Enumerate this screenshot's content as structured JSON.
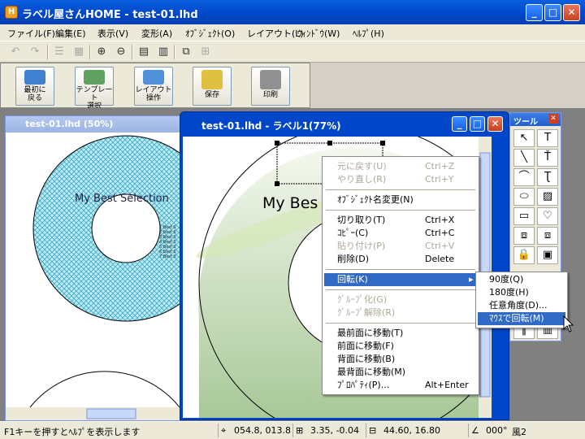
{
  "window": {
    "title": "ラベル屋さんHOME - test-01.lhd",
    "icon_label": "H"
  },
  "menu": [
    "ファイル(F)",
    "編集(E)",
    "表示(V)",
    "変形(A)",
    "ｵﾌﾞｼﾞｪｸﾄ(O)",
    "レイアウト(L)",
    "ｳｨﾝﾄﾞｳ(W)",
    "ﾍﾙﾌﾟ(H)"
  ],
  "big_buttons": [
    {
      "label1": "最初に",
      "label2": "戻る",
      "color": "#4080d0"
    },
    {
      "label1": "テンプレート",
      "label2": "選択",
      "color": "#60a060"
    },
    {
      "label1": "レイアウト",
      "label2": "操作",
      "color": "#5090d8"
    },
    {
      "label1": "保存",
      "label2": "",
      "color": "#e0c040"
    },
    {
      "label1": "印刷",
      "label2": "",
      "color": "#909090"
    }
  ],
  "doc1": {
    "title": "test-01.lhd (50%)",
    "cd_text": "My Best Selection",
    "track_lines": [
      "1.Best S",
      "2.Best S",
      "3.Best S",
      "4.Best S",
      "5.Best S",
      "6.Best S",
      "7.Best S"
    ]
  },
  "doc2": {
    "title": "test-01.lhd - ラベル1(77%)",
    "cd_text": "My Bes"
  },
  "tool": {
    "title": "ツール"
  },
  "context_menu": [
    {
      "label": "元に戻す(U)",
      "shortcut": "Ctrl+Z",
      "state": "disabled"
    },
    {
      "label": "やり直し(R)",
      "shortcut": "Ctrl+Y",
      "state": "disabled"
    },
    {
      "label": "ｵﾌﾞｼﾞｪｸﾄ名変更(N)",
      "shortcut": "",
      "state": "enabled"
    },
    {
      "label": "切り取り(T)",
      "shortcut": "Ctrl+X",
      "state": "enabled"
    },
    {
      "label": "ｺﾋﾟｰ(C)",
      "shortcut": "Ctrl+C",
      "state": "enabled"
    },
    {
      "label": "貼り付け(P)",
      "shortcut": "Ctrl+V",
      "state": "disabled"
    },
    {
      "label": "削除(D)",
      "shortcut": "Delete",
      "state": "enabled"
    },
    {
      "label": "回転(K)",
      "shortcut": "",
      "state": "selected"
    },
    {
      "label": "ｸﾞﾙｰﾌﾟ化(G)",
      "shortcut": "",
      "state": "disabled"
    },
    {
      "label": "ｸﾞﾙｰﾌﾟ解除(R)",
      "shortcut": "",
      "state": "disabled"
    },
    {
      "label": "最前面に移動(T)",
      "shortcut": "",
      "state": "enabled"
    },
    {
      "label": "前面に移動(F)",
      "shortcut": "",
      "state": "enabled"
    },
    {
      "label": "背面に移動(B)",
      "shortcut": "",
      "state": "enabled"
    },
    {
      "label": "最背面に移動(M)",
      "shortcut": "",
      "state": "enabled"
    },
    {
      "label": "ﾌﾟﾛﾊﾟﾃｨ(P)...",
      "shortcut": "Alt+Enter",
      "state": "enabled"
    }
  ],
  "submenu": [
    {
      "label": "90度(Q)",
      "state": "enabled"
    },
    {
      "label": "180度(H)",
      "state": "enabled"
    },
    {
      "label": "任意角度(D)...",
      "state": "enabled"
    },
    {
      "label": "ﾏｳｽで回転(M)",
      "state": "selected"
    }
  ],
  "status": {
    "hint": "F1キーを押すとﾍﾙﾌﾟを表示します",
    "pos": "054.8, 013.8",
    "size": "3.35, -0.04",
    "size2": "44.60, 16.80",
    "angle": "000°",
    "wind": "風2"
  },
  "colors": {
    "accent": "#316ac5",
    "title_blue": "#0046c8",
    "cd_cyan": "#66ccdd"
  }
}
